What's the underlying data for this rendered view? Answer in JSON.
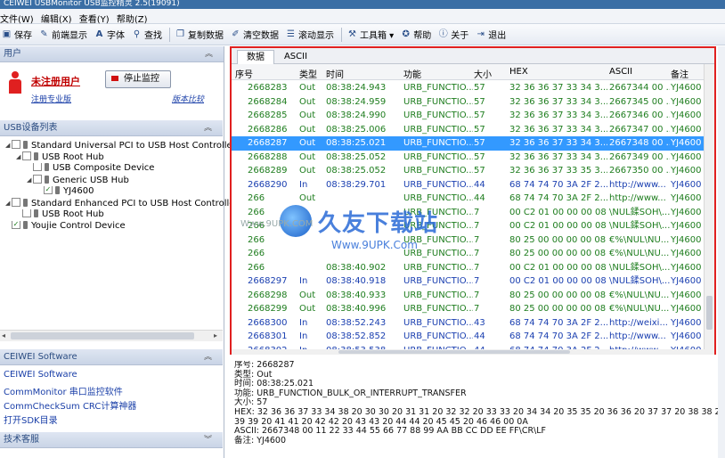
{
  "window": {
    "title": "CEIWEI USBMonitor USB监控精灵 2.5(19091)"
  },
  "menu": [
    "文件(W)",
    "编辑(X)",
    "查看(Y)",
    "帮助(Z)"
  ],
  "toolbar": [
    {
      "icon": "save-icon",
      "label": "保存"
    },
    {
      "icon": "prev-icon",
      "label": "前端显示"
    },
    {
      "icon": "font-icon",
      "label": "字体"
    },
    {
      "icon": "search-icon",
      "label": "查找"
    },
    {
      "icon": "copy-icon",
      "label": "复制数据"
    },
    {
      "icon": "clear-icon",
      "label": "清空数据"
    },
    {
      "icon": "scroll-icon",
      "label": "滚动显示"
    },
    {
      "icon": "tools-icon",
      "label": "工具箱 ▾"
    },
    {
      "icon": "help-icon",
      "label": "帮助"
    },
    {
      "icon": "about-icon",
      "label": "关于"
    },
    {
      "icon": "exit-icon",
      "label": "退出"
    }
  ],
  "user_section": {
    "header": "用户",
    "unregistered": "未注册用户",
    "stop_button": "停止监控",
    "register_link": "注册专业版",
    "version_link": "版本比较"
  },
  "usb_section": {
    "header": "USB设备列表",
    "tree": [
      {
        "label": "Standard Universal PCI to USB Host Controller",
        "level": 0,
        "checked": false,
        "expand": true
      },
      {
        "label": "USB Root Hub",
        "level": 1,
        "checked": false,
        "expand": true
      },
      {
        "label": "USB Composite Device",
        "level": 2,
        "checked": false,
        "expand": false
      },
      {
        "label": "Generic USB Hub",
        "level": 2,
        "checked": false,
        "expand": true
      },
      {
        "label": "YJ4600",
        "level": 3,
        "checked": true,
        "expand": false
      },
      {
        "label": "Standard Enhanced PCI to USB Host Controlle",
        "level": 0,
        "checked": false,
        "expand": true
      },
      {
        "label": "USB Root Hub",
        "level": 1,
        "checked": false,
        "expand": false
      },
      {
        "label": "Youjie Control Device",
        "level": 0,
        "checked": true,
        "expand": false
      }
    ]
  },
  "software_section": {
    "header": "CEIWEI Software",
    "links": [
      "CEIWEI Software",
      "CommMonitor 串口监控软件",
      "CommCheckSum CRC计算神器",
      "打开SDK目录"
    ]
  },
  "support_section": {
    "header": "技术客服"
  },
  "tabs": [
    "数据",
    "ASCII"
  ],
  "grid": {
    "columns": [
      "序号",
      "类型",
      "时间",
      "功能",
      "大小",
      "HEX",
      "ASCII",
      "备注"
    ],
    "rows": [
      [
        "2668283",
        "Out",
        "08:38:24.943",
        "URB_FUNCTIO...",
        "57",
        "32 36 36 37 33 34 3...",
        "2667344 00 ...",
        "YJ4600"
      ],
      [
        "2668284",
        "Out",
        "08:38:24.959",
        "URB_FUNCTIO...",
        "57",
        "32 36 36 37 33 34 3...",
        "2667345 00 ...",
        "YJ4600"
      ],
      [
        "2668285",
        "Out",
        "08:38:24.990",
        "URB_FUNCTIO...",
        "57",
        "32 36 36 37 33 34 3...",
        "2667346 00 ...",
        "YJ4600"
      ],
      [
        "2668286",
        "Out",
        "08:38:25.006",
        "URB_FUNCTIO...",
        "57",
        "32 36 36 37 33 34 3...",
        "2667347 00 ...",
        "YJ4600"
      ],
      [
        "2668287",
        "Out",
        "08:38:25.021",
        "URB_FUNCTIO...",
        "57",
        "32 36 36 37 33 34 3...",
        "2667348 00 ...",
        "YJ4600"
      ],
      [
        "2668288",
        "Out",
        "08:38:25.052",
        "URB_FUNCTIO...",
        "57",
        "32 36 36 37 33 34 3...",
        "2667349 00 ...",
        "YJ4600"
      ],
      [
        "2668289",
        "Out",
        "08:38:25.052",
        "URB_FUNCTIO...",
        "57",
        "32 36 36 37 33 35 3...",
        "2667350 00 ...",
        "YJ4600"
      ],
      [
        "2668290",
        "In",
        "08:38:29.701",
        "URB_FUNCTIO...",
        "44",
        "68 74 74 70 3A 2F 2...",
        "http://www...",
        "YJ4600"
      ],
      [
        "266",
        "Out",
        "",
        "URB_FUNCTIO...",
        "44",
        "68 74 74 70 3A 2F 2...",
        "http://www...",
        "YJ4600"
      ],
      [
        "266",
        "",
        "",
        "URB_FUNCTIO...",
        "7",
        "00 C2 01 00 00 00 08",
        "\\NUL鍒SOH\\...",
        "YJ4600"
      ],
      [
        "266",
        "",
        "",
        "URB_FUNCTIO...",
        "7",
        "00 C2 01 00 00 00 08",
        "\\NUL鍒SOH\\...",
        "YJ4600"
      ],
      [
        "266",
        "",
        "",
        "URB_FUNCTIO...",
        "7",
        "80 25 00 00 00 00 08",
        "€%\\NUL\\NU...",
        "YJ4600"
      ],
      [
        "266",
        "",
        "",
        "URB_FUNCTIO...",
        "7",
        "80 25 00 00 00 00 08",
        "€%\\NUL\\NU...",
        "YJ4600"
      ],
      [
        "266",
        "",
        "08:38:40.902",
        "URB_FUNCTIO...",
        "7",
        "00 C2 01 00 00 00 08",
        "\\NUL鍒SOH\\...",
        "YJ4600"
      ],
      [
        "2668297",
        "In",
        "08:38:40.918",
        "URB_FUNCTIO...",
        "7",
        "00 C2 01 00 00 00 08",
        "\\NUL鍒SOH\\...",
        "YJ4600"
      ],
      [
        "2668298",
        "Out",
        "08:38:40.933",
        "URB_FUNCTIO...",
        "7",
        "80 25 00 00 00 00 08",
        "€%\\NUL\\NU...",
        "YJ4600"
      ],
      [
        "2668299",
        "Out",
        "08:38:40.996",
        "URB_FUNCTIO...",
        "7",
        "80 25 00 00 00 00 08",
        "€%\\NUL\\NU...",
        "YJ4600"
      ],
      [
        "2668300",
        "In",
        "08:38:52.243",
        "URB_FUNCTIO...",
        "43",
        "68 74 74 70 3A 2F 2...",
        "http://weixi...",
        "YJ4600"
      ],
      [
        "2668301",
        "In",
        "08:38:52.852",
        "URB_FUNCTIO...",
        "44",
        "68 74 74 70 3A 2F 2...",
        "http://www...",
        "YJ4600"
      ],
      [
        "2668302",
        "In",
        "08:38:53.538",
        "URB_FUNCTIO...",
        "44",
        "68 74 74 70 3A 2F 2...",
        "http://www...",
        "YJ4600"
      ]
    ],
    "selected_index": 4
  },
  "detail": [
    "序号: 2668287",
    "类型: Out",
    "时间: 08:38:25.021",
    "功能: URB_FUNCTION_BULK_OR_INTERRUPT_TRANSFER",
    "大小: 57",
    "HEX: 32 36 36 37 33 34 38 20 30 30 20 31 31 20 32 32 20 33 33 20 34 34 20 35 35 20 36 36 20 37 37 20 38 38 20",
    "39 39 20 41 41 20 42 42 20 43 43 20 44 44 20 45 45 20 46 46 00 0A",
    "ASCII: 2667348 00 11 22 33 44 55 66 77 88 99 AA BB CC DD EE FF\\CR\\LF",
    "备注: YJ4600"
  ],
  "watermark": {
    "brand": "久友下载站",
    "url": "Www.9UPK.Com",
    "small": "Www.9UPK.COM"
  }
}
